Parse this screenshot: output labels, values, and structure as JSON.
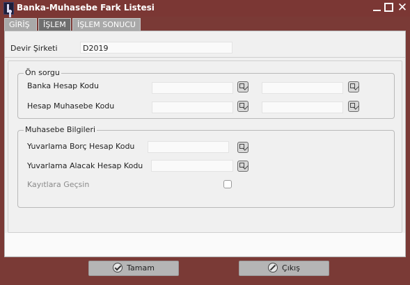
{
  "window": {
    "title": "Banka-Muhasebe Fark Listesi",
    "close_glyph": "✕"
  },
  "tabs": [
    {
      "label": "GİRİŞ"
    },
    {
      "label": "İŞLEM"
    },
    {
      "label": "İŞLEM SONUCU"
    }
  ],
  "form": {
    "devir_label": "Devir Şirketi",
    "devir_value": "D2019",
    "on_sorgu": {
      "title": "Ön sorgu",
      "banka_label": "Banka Hesap Kodu",
      "hesap_label": "Hesap Muhasebe Kodu",
      "banka_from": "",
      "banka_to": "",
      "hesap_from": "",
      "hesap_to": ""
    },
    "muhasebe": {
      "title": "Muhasebe Bilgileri",
      "borc_label": "Yuvarlama Borç Hesap Kodu",
      "alacak_label": "Yuvarlama Alacak Hesap Kodu",
      "kayit_label": "Kayıtlara Geçsin",
      "borc_value": "",
      "alacak_value": "",
      "kayit_checked": false
    }
  },
  "buttons": {
    "ok_label": "Tamam",
    "cancel_label": "Çıkış"
  }
}
